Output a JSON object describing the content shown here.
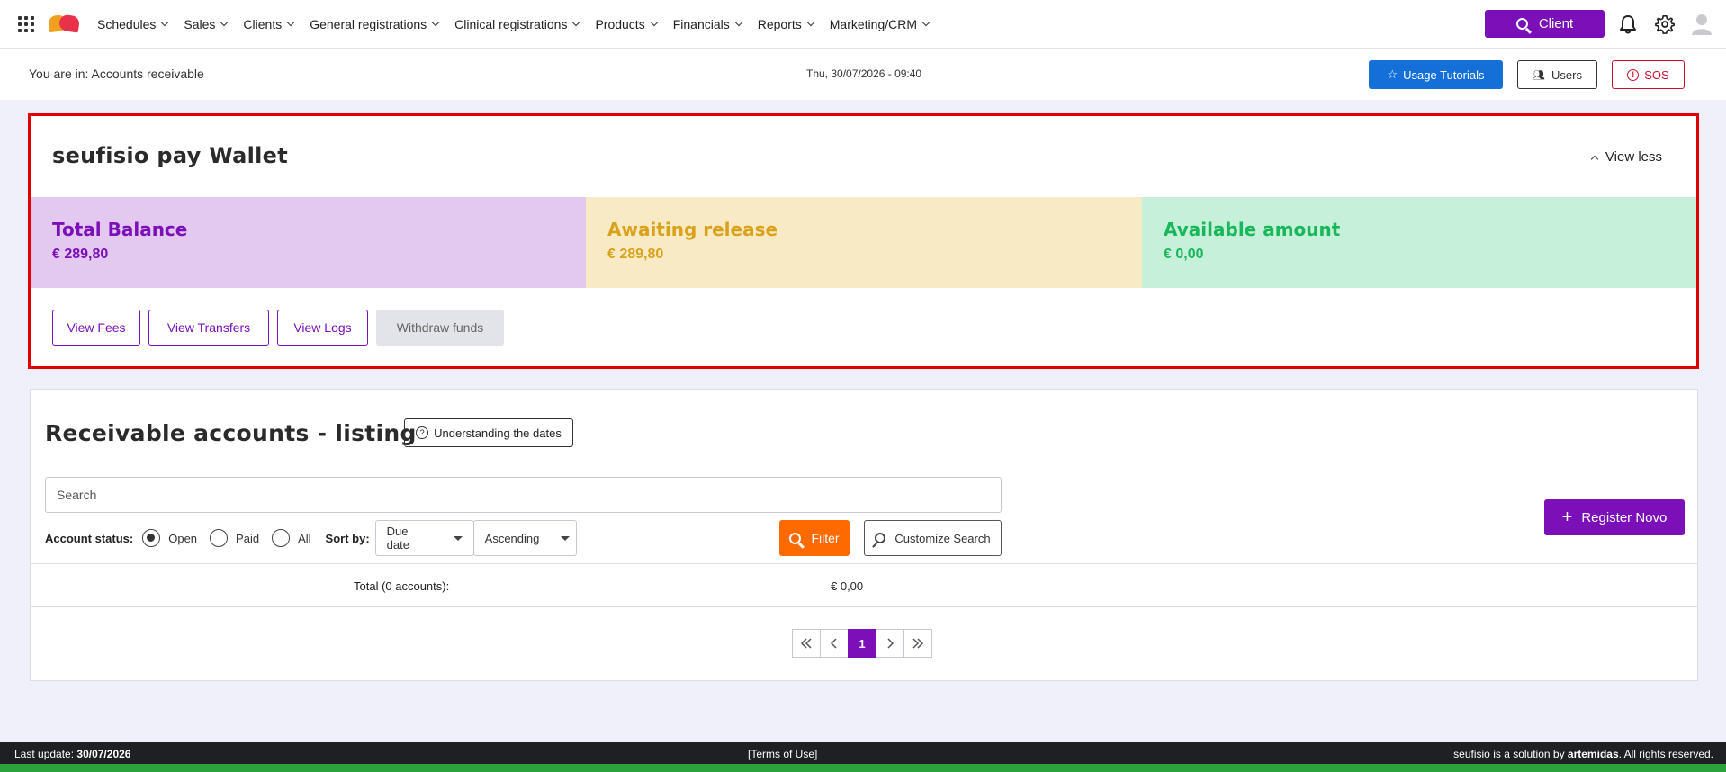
{
  "nav": {
    "items": [
      {
        "label": "Schedules"
      },
      {
        "label": "Sales"
      },
      {
        "label": "Clients"
      },
      {
        "label": "General registrations"
      },
      {
        "label": "Clinical registrations"
      },
      {
        "label": "Products"
      },
      {
        "label": "Financials"
      },
      {
        "label": "Reports"
      },
      {
        "label": "Marketing/CRM"
      }
    ],
    "client_button": "Client"
  },
  "subbar": {
    "breadcrumb": "You are in: Accounts receivable",
    "datetime": "Thu, 30/07/2026 - 09:40",
    "tutorials_label": "Usage Tutorials",
    "users_label": "Users",
    "sos_label": "SOS"
  },
  "wallet": {
    "title": "seufisio pay Wallet",
    "view_less": "View less",
    "cards": {
      "total": {
        "title": "Total Balance",
        "value": "€ 289,80",
        "color": "#7b0fb8"
      },
      "awaiting": {
        "title": "Awaiting release",
        "value": "€ 289,80",
        "color": "#d9a21a"
      },
      "available": {
        "title": "Available amount",
        "value": "€ 0,00",
        "color": "#18b85a"
      }
    },
    "actions": {
      "fees": "View Fees",
      "transfers": "View Transfers",
      "logs": "View Logs",
      "withdraw": "Withdraw funds"
    }
  },
  "listing": {
    "title": "Receivable accounts - listing",
    "dates_help": "Understanding the dates",
    "search_placeholder": "Search",
    "account_status_label": "Account status:",
    "status_options": {
      "open": "Open",
      "paid": "Paid",
      "all": "All"
    },
    "status_selected": "Open",
    "sort_by_label": "Sort by:",
    "sort_field": "Due date",
    "sort_order": "Ascending",
    "filter_label": "Filter",
    "customize_label": "Customize Search",
    "register_label": "Register Novo",
    "total_label": "Total (0 accounts):",
    "total_value": "€ 0,00",
    "pagination": {
      "current_page": "1"
    }
  },
  "footer": {
    "last_update_label": "Last update:",
    "last_update_date": "30/07/2026",
    "terms": "[Terms of Use]",
    "credit_prefix": "seufisio is a solution by",
    "credit_company": "artemidas",
    "credit_suffix": ". All rights reserved."
  },
  "colors": {
    "brand": "#7b0fb8",
    "primary_blue": "#1470d8",
    "filter_orange": "#ff6a00",
    "alert_red": "#c8102e"
  }
}
